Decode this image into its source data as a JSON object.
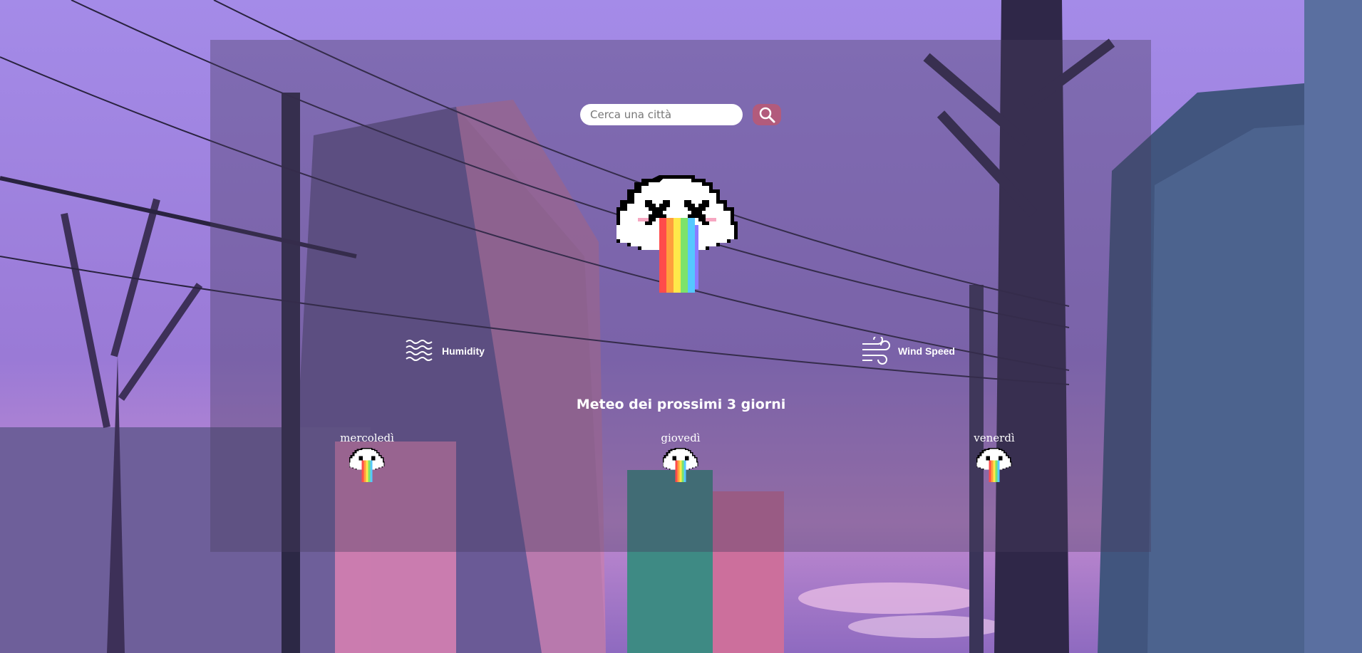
{
  "search": {
    "placeholder": "Cerca una città",
    "value": "",
    "button_icon": "search-icon"
  },
  "current": {
    "icon": "rainbow-cloud-icon"
  },
  "stats": {
    "humidity": {
      "icon": "waves-icon",
      "label": "Humidity"
    },
    "wind": {
      "icon": "wind-icon",
      "label": "Wind Speed"
    }
  },
  "forecast": {
    "title": "Meteo dei prossimi 3 giorni",
    "days": [
      {
        "name": "mercoledì",
        "icon": "rainbow-cloud-icon"
      },
      {
        "name": "giovedì",
        "icon": "rainbow-cloud-icon"
      },
      {
        "name": "venerdì",
        "icon": "rainbow-cloud-icon"
      }
    ]
  },
  "colors": {
    "accent": "#b25b7c",
    "panel": "#463c5f",
    "text": "#ffffff"
  }
}
